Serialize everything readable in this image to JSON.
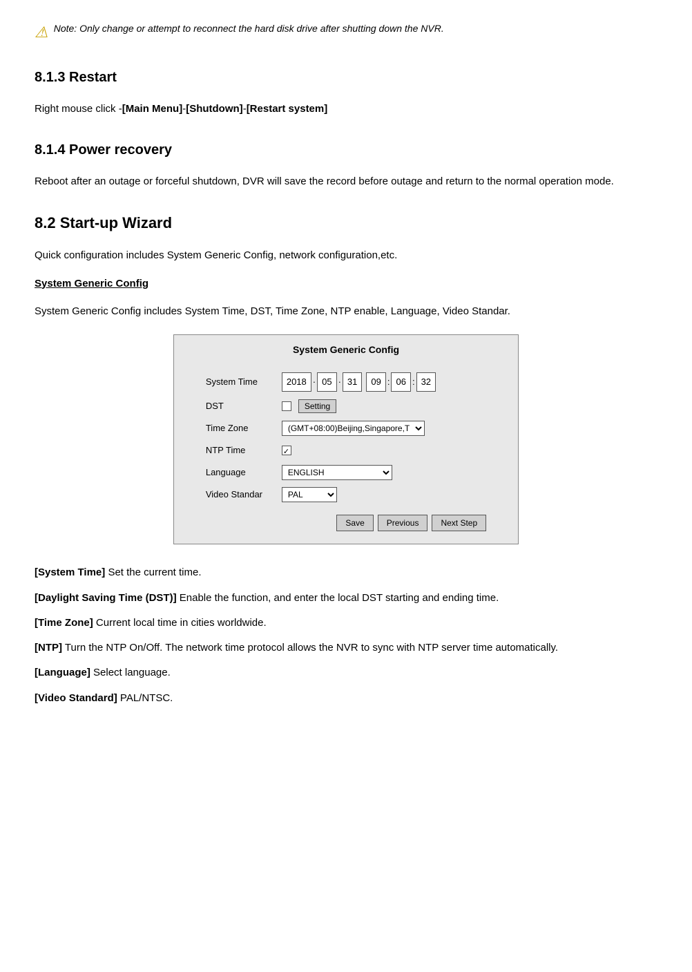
{
  "note": {
    "icon": "⚠",
    "text": "Note: Only change or attempt to reconnect the hard disk drive after shutting down the NVR."
  },
  "section_8_1_3": {
    "heading": "8.1.3  Restart",
    "body": "Right mouse click -[Main Menu]-[Shutdown]-[Restart system]"
  },
  "section_8_1_4": {
    "heading": "8.1.4  Power recovery",
    "body": "Reboot after an outage or forceful shutdown, DVR will save the record before outage and return to the normal operation mode."
  },
  "section_8_2": {
    "heading": "8.2  Start-up Wizard",
    "intro": "Quick configuration includes System Generic Config, network configuration,etc.",
    "subheading": "System Generic Config",
    "subheading_body": "System Generic Config includes System Time, DST, Time Zone, NTP enable, Language, Video Standar.",
    "ui": {
      "title": "System Generic Config",
      "fields": [
        {
          "label": "System Time",
          "type": "time",
          "date": "2018",
          "sep1": "·",
          "month": "05",
          "sep2": "·",
          "day": "31",
          "hour": "09",
          "sep3": ":",
          "minute": "06",
          "sep4": ":",
          "second": "32"
        },
        {
          "label": "DST",
          "type": "checkbox_button",
          "button_label": "Setting"
        },
        {
          "label": "Time Zone",
          "type": "select",
          "value": "(GMT+08:00)Beijing,Singapore,T"
        },
        {
          "label": "NTP Time",
          "type": "checkbox_checked"
        },
        {
          "label": "Language",
          "type": "select",
          "value": "ENGLISH"
        },
        {
          "label": "Video Standar",
          "type": "select",
          "value": "PAL"
        }
      ],
      "buttons": {
        "save": "Save",
        "previous": "Previous",
        "next_step": "Next Step"
      }
    }
  },
  "params": [
    {
      "label": "[System Time]",
      "text": "Set the current time."
    },
    {
      "label": "[Daylight Saving Time (DST)]",
      "text": "Enable the function, and enter the local DST starting and ending time."
    },
    {
      "label": "[Time Zone]",
      "text": "Current local time in cities worldwide."
    },
    {
      "label": "[NTP]",
      "text": " Turn the NTP On/Off.  The network time protocol allows the NVR to sync with NTP server time automatically."
    },
    {
      "label": "[Language]",
      "text": "Select language."
    },
    {
      "label": "[Video Standard]",
      "text": "PAL/NTSC."
    }
  ]
}
